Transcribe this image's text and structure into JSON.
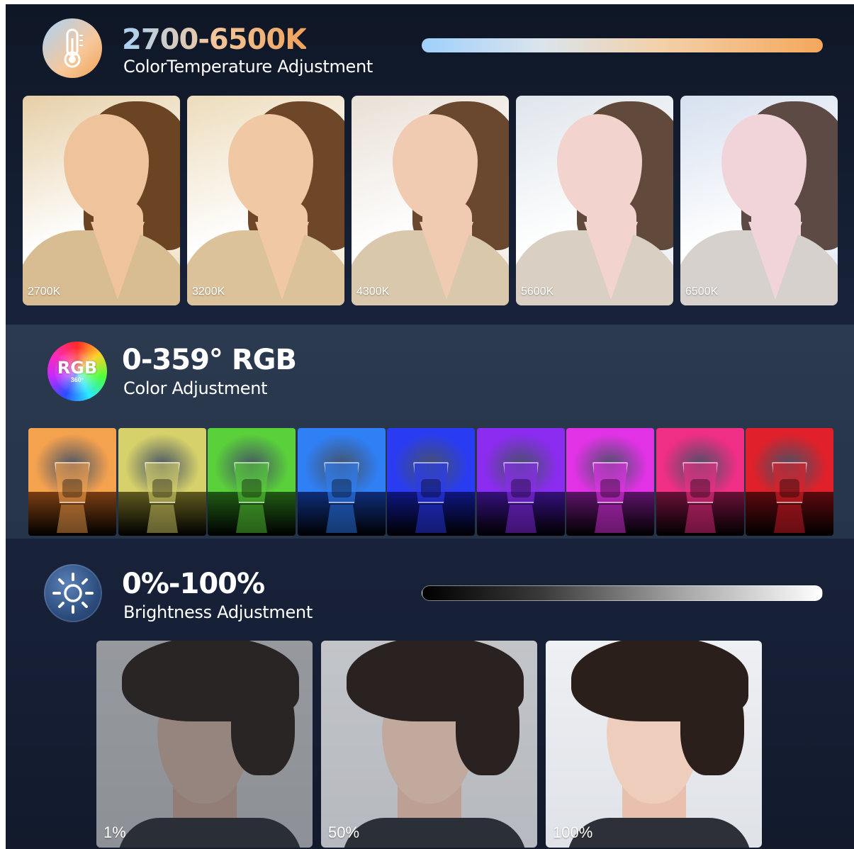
{
  "temperature": {
    "headline": "2700-6500K",
    "subline": "ColorTemperature Adjustment",
    "icon": "thermometer-icon",
    "bar_colors": [
      "#9fd0fb",
      "#f4a85b"
    ],
    "samples": [
      {
        "label": "2700K",
        "tone": "#e6cfa6",
        "skin": "#efc39c",
        "hair": "#6b4424",
        "coat": "#d8bc92"
      },
      {
        "label": "3200K",
        "tone": "#eddcbc",
        "skin": "#f0c8a4",
        "hair": "#6e4628",
        "coat": "#dcc29a"
      },
      {
        "label": "4300K",
        "tone": "#e9e0d6",
        "skin": "#f0cbb2",
        "hair": "#6a4830",
        "coat": "#dac8ad"
      },
      {
        "label": "5600K",
        "tone": "#dfe5ec",
        "skin": "#f3d3cd",
        "hair": "#61493c",
        "coat": "#d9cfc2"
      },
      {
        "label": "6500K",
        "tone": "#d6e0ef",
        "skin": "#f1d4d9",
        "hair": "#5d4a44",
        "coat": "#d6d1cd"
      }
    ]
  },
  "rgb": {
    "headline": "0-359° RGB",
    "subline": "Color Adjustment",
    "icon_text": "RGB",
    "icon_subtext": "360°",
    "tiles": [
      {
        "wall": "#f5a24e",
        "table": "#7a3d12"
      },
      {
        "wall": "#d6d16a",
        "table": "#5f5a1e"
      },
      {
        "wall": "#5ad13a",
        "table": "#1f5a13"
      },
      {
        "wall": "#2f7ff5",
        "table": "#0e2d78"
      },
      {
        "wall": "#2a3cf2",
        "table": "#0f1680"
      },
      {
        "wall": "#8b2cf0",
        "table": "#35107a"
      },
      {
        "wall": "#e232e6",
        "table": "#5d1268"
      },
      {
        "wall": "#ef2e86",
        "table": "#6a1038"
      },
      {
        "wall": "#e0202a",
        "table": "#5c0a0e"
      }
    ]
  },
  "brightness": {
    "headline": "0%-100%",
    "subline": "Brightness Adjustment",
    "icon": "sun-icon",
    "samples": [
      {
        "label": "1%",
        "level": 0.01
      },
      {
        "label": "50%",
        "level": 0.5
      },
      {
        "label": "100%",
        "level": 1.0
      }
    ]
  }
}
